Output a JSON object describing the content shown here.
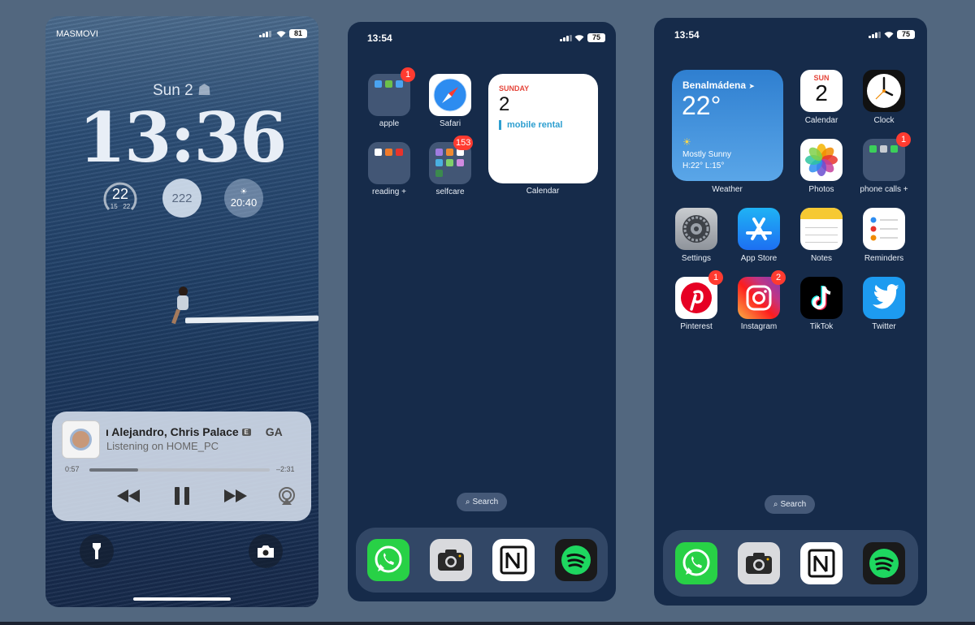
{
  "lock": {
    "carrier": "MASMOVI",
    "battery": "81",
    "date": "Sun 2",
    "time": "13:36",
    "widget_temp": "22",
    "widget_low": "15",
    "widget_high": "22",
    "widget_mid": "222",
    "widget_sun": "20:40",
    "player": {
      "title": "ı Alejandro, Chris Palace",
      "explicit": "E",
      "next": "GA",
      "subtitle": "Listening on HOME_PC",
      "elapsed": "0:57",
      "remaining": "–2:31",
      "progress": 0.27
    }
  },
  "screen2": {
    "time": "13:54",
    "battery": "75",
    "apps": [
      {
        "label": "apple",
        "badge": "1"
      },
      {
        "label": "Safari"
      },
      {
        "label": "reading +"
      },
      {
        "label": "selfcare",
        "badge": "153"
      }
    ],
    "calendar_widget": {
      "day": "SUNDAY",
      "date": "2",
      "event": "mobile rental",
      "label": "Calendar"
    },
    "search": "Search"
  },
  "screen3": {
    "time": "13:54",
    "battery": "75",
    "weather": {
      "location": "Benalmádena",
      "temp": "22°",
      "condition": "Mostly Sunny",
      "hilo": "H:22° L:15°",
      "label": "Weather"
    },
    "calendar": {
      "day": "SUN",
      "date": "2",
      "label": "Calendar"
    },
    "clock_label": "Clock",
    "photos_label": "Photos",
    "phone_calls": {
      "label": "phone calls +",
      "badge": "1"
    },
    "row3": [
      {
        "label": "Settings"
      },
      {
        "label": "App Store"
      },
      {
        "label": "Notes"
      },
      {
        "label": "Reminders"
      }
    ],
    "row4": [
      {
        "label": "Pinterest",
        "badge": "1"
      },
      {
        "label": "Instagram",
        "badge": "2"
      },
      {
        "label": "TikTok"
      },
      {
        "label": "Twitter"
      }
    ],
    "search": "Search"
  },
  "dock_apps": [
    "whatsapp-icon",
    "camera-icon",
    "notion-icon",
    "spotify-icon"
  ],
  "colors": {
    "badge": "#ff3b30",
    "home_bg": "#162b4a",
    "page_bg": "#52677f",
    "calendar_red": "#e5463b"
  }
}
